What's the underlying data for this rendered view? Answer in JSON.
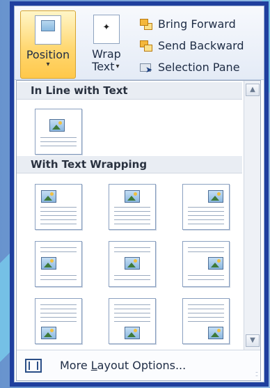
{
  "ribbon": {
    "position": {
      "label": "Position",
      "caret": "▾"
    },
    "wrap_text": {
      "label_line1": "Wrap",
      "label_line2": "Text",
      "caret": "▾"
    },
    "bring_forward": {
      "label": "Bring Forward"
    },
    "send_backward": {
      "label": "Send Backward"
    },
    "selection_pane": {
      "label": "Selection Pane"
    }
  },
  "dropdown": {
    "section_inline": "In Line with Text",
    "section_wrapping": "With Text Wrapping",
    "more_layout_options": {
      "pre": "More ",
      "accel": "L",
      "post": "ayout Options..."
    },
    "scroll_up": "▲",
    "scroll_down": "▼",
    "grip": "⁚⁚"
  }
}
